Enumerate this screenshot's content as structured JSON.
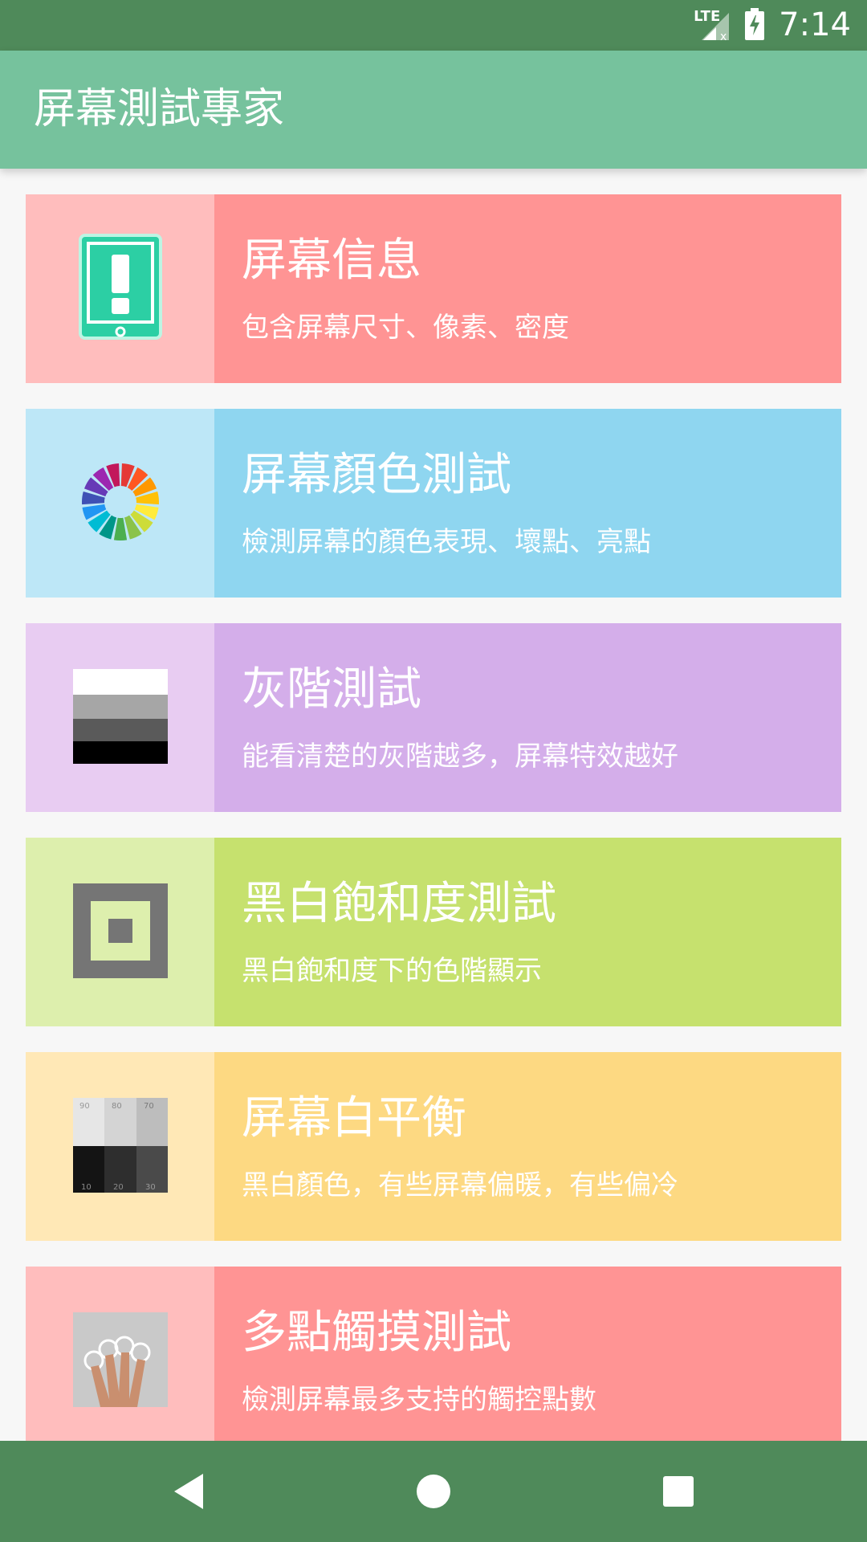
{
  "status": {
    "network": "LTE",
    "time": "7:14"
  },
  "app": {
    "title": "屏幕測試專家"
  },
  "colors": {
    "statusbar": "#4f8a5a",
    "appbar": "#76c29d"
  },
  "items": [
    {
      "title": "屏幕信息",
      "subtitle": "包含屏幕尺寸、像素、密度",
      "icon": "phone-alert-icon",
      "left_color": "#ffbdbd",
      "right_color": "#ff9494"
    },
    {
      "title": "屏幕顏色測試",
      "subtitle": "檢測屏幕的顏色表現、壞點、亮點",
      "icon": "color-wheel-icon",
      "left_color": "#bde7f7",
      "right_color": "#8fd6f0"
    },
    {
      "title": "灰階測試",
      "subtitle": "能看清楚的灰階越多，屏幕特效越好",
      "icon": "grayscale-bars-icon",
      "left_color": "#e8ccf2",
      "right_color": "#d4aeea"
    },
    {
      "title": "黑白飽和度測試",
      "subtitle": "黑白飽和度下的色階顯示",
      "icon": "saturation-square-icon",
      "left_color": "#ddefad",
      "right_color": "#c6e16e"
    },
    {
      "title": "屏幕白平衡",
      "subtitle": "黑白顏色，有些屏幕偏暖，有些偏冷",
      "icon": "white-balance-icon",
      "left_color": "#ffe8b6",
      "right_color": "#fdd982",
      "wb_top_labels": [
        "90",
        "80",
        "70"
      ],
      "wb_bottom_labels": [
        "10",
        "20",
        "30"
      ]
    },
    {
      "title": "多點觸摸測試",
      "subtitle": "檢測屏幕最多支持的觸控點數",
      "icon": "multitouch-hand-icon",
      "left_color": "#ffbdbd",
      "right_color": "#ff9494"
    }
  ]
}
